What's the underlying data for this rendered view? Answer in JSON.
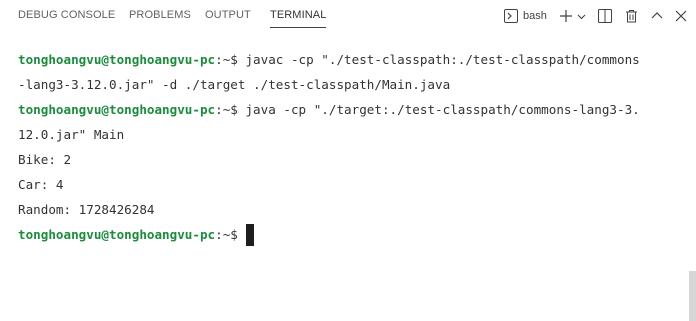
{
  "panel": {
    "tabs": [
      {
        "label": "DEBUG CONSOLE"
      },
      {
        "label": "PROBLEMS"
      },
      {
        "label": "OUTPUT"
      },
      {
        "label": "TERMINAL"
      }
    ],
    "active_tab": "TERMINAL",
    "toolbar": {
      "terminal_name": "bash",
      "icons": [
        "terminal-icon",
        "plus-icon",
        "chevron-down-icon",
        "split-icon",
        "trash-icon",
        "chevron-up-icon",
        "close-icon"
      ]
    }
  },
  "terminal": {
    "prompt": "tonghoangvu@tonghoangvu-pc",
    "prompt_suffix": ":~$",
    "lines": [
      {
        "prompt": "tonghoangvu@tonghoangvu-pc",
        "suffix": ":~$",
        "text": " javac -cp \"./test-classpath:./test-classpath/commons"
      },
      {
        "text": "-lang3-3.12.0.jar\" -d ./target ./test-classpath/Main.java"
      },
      {
        "prompt": "tonghoangvu@tonghoangvu-pc",
        "suffix": ":~$",
        "text": " java -cp \"./target:./test-classpath/commons-lang3-3."
      },
      {
        "text": "12.0.jar\" Main"
      },
      {
        "text": "Bike: 2"
      },
      {
        "text": "Car: 4"
      },
      {
        "text": "Random: 1728426284"
      },
      {
        "prompt": "tonghoangvu@tonghoangvu-pc",
        "suffix": ":~$",
        "text": " "
      }
    ]
  },
  "colors": {
    "prompt": "#1a8c3c",
    "text": "#333333",
    "tab_inactive": "#616161",
    "tab_active": "#333333",
    "background": "#ffffff"
  }
}
